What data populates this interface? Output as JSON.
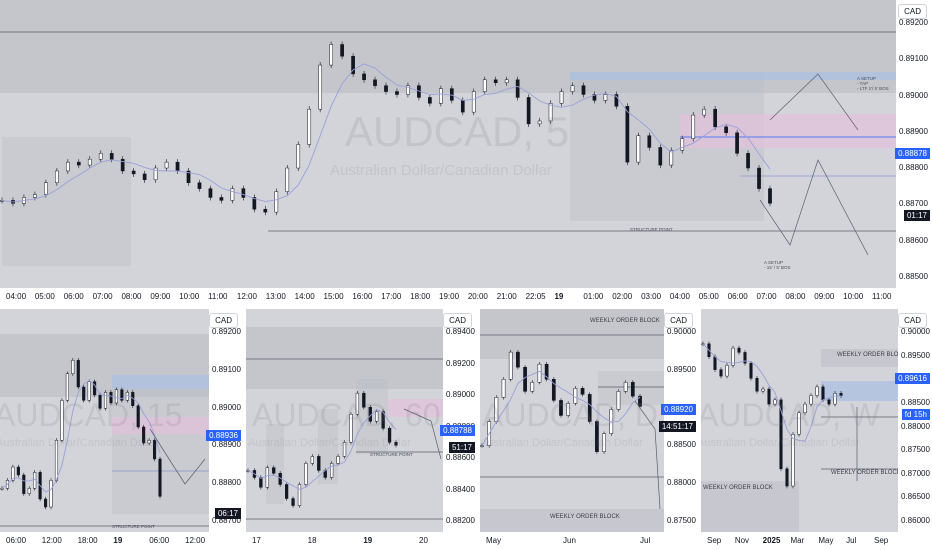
{
  "colors": {
    "up": "#131722",
    "down": "#131722",
    "ma": "#9b9fd8",
    "badge_blue": "#2962ff",
    "badge_dark": "#131722",
    "zone_gray": "#b8bac1",
    "zone_pink": "#e3c1dc",
    "zone_blue": "#aebfe0"
  },
  "chart_data": [
    {
      "type": "candlestick",
      "panel": "main",
      "watermark_symbol": "AUDCAD, 5",
      "watermark_name": "Australian Dollar/Canadian Dollar",
      "currency": "CAD",
      "y_ticks": [
        "0.89200",
        "0.89100",
        "0.89000",
        "0.88900",
        "0.88800",
        "0.88700",
        "0.88600",
        "0.88500"
      ],
      "x_ticks": [
        "04:00",
        "05:00",
        "06:00",
        "07:00",
        "08:00",
        "09:00",
        "10:00",
        "11:00",
        "12:00",
        "13:00",
        "14:00",
        "15:00",
        "16:00",
        "17:00",
        "18:00",
        "19:00",
        "20:00",
        "21:00",
        "22:05",
        "19",
        "01:00",
        "02:00",
        "03:00",
        "04:00",
        "05:00",
        "06:00",
        "07:00",
        "08:00",
        "09:00",
        "10:00",
        "11:00"
      ],
      "ylim": [
        0.8845,
        0.8931
      ],
      "last_price": "0.88878",
      "timer": "01:17",
      "annotations": [
        "STRUCTURE POINT",
        "A SETUP",
        "- TAP",
        "- LTF 1'/ 5' BOS",
        "A SETUP",
        "- 15' / 5' BOS"
      ],
      "ohlc_path": [
        0.8869,
        0.8868,
        0.887,
        0.8871,
        0.8875,
        0.8879,
        0.8882,
        0.8881,
        0.8883,
        0.8885,
        0.8883,
        0.8879,
        0.8878,
        0.8876,
        0.888,
        0.8882,
        0.8879,
        0.8875,
        0.8873,
        0.887,
        0.8869,
        0.8873,
        0.887,
        0.8866,
        0.8865,
        0.8872,
        0.888,
        0.8888,
        0.89,
        0.8915,
        0.8922,
        0.8918,
        0.8912,
        0.891,
        0.8908,
        0.8906,
        0.8905,
        0.8908,
        0.8904,
        0.8902,
        0.8907,
        0.8903,
        0.8899,
        0.8906,
        0.891,
        0.8909,
        0.891,
        0.8904,
        0.8895,
        0.8896,
        0.8902,
        0.8906,
        0.8908,
        0.8905,
        0.8903,
        0.8905,
        0.8901,
        0.8882,
        0.8891,
        0.8887,
        0.8881,
        0.8886,
        0.889,
        0.8898,
        0.89,
        0.8894,
        0.8892,
        0.8885,
        0.888,
        0.8873,
        0.8868
      ]
    },
    {
      "type": "candlestick",
      "panel": "bottom-1",
      "watermark_symbol": "AUDCAD, 15",
      "watermark_name": "Australian Dollar/Canadian Dollar",
      "currency": "CAD",
      "y_ticks": [
        "0.89200",
        "0.89100",
        "0.89000",
        "0.88900",
        "0.88800",
        "0.88700"
      ],
      "x_ticks": [
        "06:00",
        "12:00",
        "18:00",
        "19",
        "06:00",
        "12:00"
      ],
      "ylim": [
        0.8862,
        0.8931
      ],
      "last_price": "0.88936",
      "timer": "06:17",
      "annotations": [
        "STRUCTURE POINT"
      ],
      "ohlc_path": [
        0.8872,
        0.8875,
        0.888,
        0.8877,
        0.887,
        0.8872,
        0.8878,
        0.8868,
        0.8865,
        0.8875,
        0.889,
        0.8905,
        0.8915,
        0.892,
        0.891,
        0.8905,
        0.8912,
        0.8907,
        0.8902,
        0.8908,
        0.8904,
        0.8909,
        0.8905,
        0.8908,
        0.8903,
        0.8895,
        0.8889,
        0.889,
        0.8883,
        0.8869
      ]
    },
    {
      "type": "candlestick",
      "panel": "bottom-2",
      "watermark_symbol": "AUDCAD, 60",
      "watermark_name": "Australian Dollar/Canadian Dollar",
      "currency": "CAD",
      "y_ticks": [
        "0.89400",
        "0.89200",
        "0.89000",
        "0.88800",
        "0.88600",
        "0.88400",
        "0.88200"
      ],
      "x_ticks": [
        "17",
        "18",
        "19",
        "20"
      ],
      "ylim": [
        0.8814,
        0.8945
      ],
      "last_price": "0.88788",
      "timer": "51:17",
      "annotations": [
        "STRUCTURE POINT"
      ],
      "ohlc_path": [
        0.885,
        0.8845,
        0.8838,
        0.8852,
        0.8848,
        0.884,
        0.883,
        0.8825,
        0.884,
        0.8855,
        0.886,
        0.885,
        0.8845,
        0.8855,
        0.886,
        0.887,
        0.889,
        0.8905,
        0.8895,
        0.8885,
        0.8892,
        0.888,
        0.887,
        0.8868
      ]
    },
    {
      "type": "candlestick",
      "panel": "bottom-3",
      "watermark_symbol": "AUDCAD, D",
      "watermark_name": "Australian Dollar/Canadian Dollar",
      "currency": "CAD",
      "y_ticks": [
        "0.90000",
        "0.89500",
        "0.89000",
        "0.88500",
        "0.88000",
        "0.87500"
      ],
      "x_ticks": [
        "May",
        "Jun",
        "Jul"
      ],
      "ylim": [
        0.8725,
        0.902
      ],
      "last_price": "0.88920",
      "timer": "14:51:17",
      "annotations": [
        "WEEKLY ORDER BLOCK",
        "WEEKLY ORDER BLOCK"
      ],
      "ohlc_path": [
        0.883,
        0.887,
        0.891,
        0.894,
        0.8985,
        0.896,
        0.892,
        0.8935,
        0.8965,
        0.894,
        0.8905,
        0.888,
        0.89,
        0.8925,
        0.8915,
        0.887,
        0.882,
        0.885,
        0.889,
        0.892,
        0.8935,
        0.8912,
        0.8895
      ]
    },
    {
      "type": "candlestick",
      "panel": "bottom-4",
      "watermark_symbol": "AUDCAD, W",
      "watermark_name": "Australian Dollar/Canadian Dollar",
      "currency": "CAD",
      "y_ticks": [
        "0.90000",
        "0.89500",
        "0.89000",
        "0.88500",
        "0.88000",
        "0.87500",
        "0.87000",
        "0.86500",
        "0.86000"
      ],
      "x_ticks": [
        "Sep",
        "Nov",
        "2025",
        "Mar",
        "May",
        "Jul",
        "Sep"
      ],
      "ylim": [
        0.8585,
        0.9035
      ],
      "last_price": "0.89616",
      "timer": "fd 15h",
      "annotations": [
        "WEEKLY ORDER BLOCK",
        "WEEKLY ORDER BLOCK",
        "WEEKLY ORDER BLOCK"
      ],
      "ohlc_path": [
        0.901,
        0.898,
        0.895,
        0.8935,
        0.896,
        0.9,
        0.899,
        0.8965,
        0.893,
        0.89,
        0.8905,
        0.887,
        0.888,
        0.872,
        0.868,
        0.88,
        0.885,
        0.887,
        0.889,
        0.891,
        0.888,
        0.887,
        0.8895,
        0.889
      ]
    }
  ]
}
